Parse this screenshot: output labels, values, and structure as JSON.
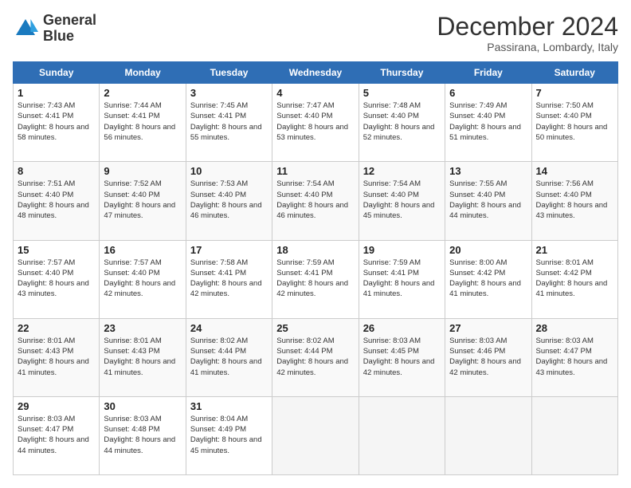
{
  "header": {
    "logo_line1": "General",
    "logo_line2": "Blue",
    "month": "December 2024",
    "location": "Passirana, Lombardy, Italy"
  },
  "weekdays": [
    "Sunday",
    "Monday",
    "Tuesday",
    "Wednesday",
    "Thursday",
    "Friday",
    "Saturday"
  ],
  "weeks": [
    [
      {
        "day": "1",
        "sunrise": "7:43 AM",
        "sunset": "4:41 PM",
        "daylight": "8 hours and 58 minutes."
      },
      {
        "day": "2",
        "sunrise": "7:44 AM",
        "sunset": "4:41 PM",
        "daylight": "8 hours and 56 minutes."
      },
      {
        "day": "3",
        "sunrise": "7:45 AM",
        "sunset": "4:41 PM",
        "daylight": "8 hours and 55 minutes."
      },
      {
        "day": "4",
        "sunrise": "7:47 AM",
        "sunset": "4:40 PM",
        "daylight": "8 hours and 53 minutes."
      },
      {
        "day": "5",
        "sunrise": "7:48 AM",
        "sunset": "4:40 PM",
        "daylight": "8 hours and 52 minutes."
      },
      {
        "day": "6",
        "sunrise": "7:49 AM",
        "sunset": "4:40 PM",
        "daylight": "8 hours and 51 minutes."
      },
      {
        "day": "7",
        "sunrise": "7:50 AM",
        "sunset": "4:40 PM",
        "daylight": "8 hours and 50 minutes."
      }
    ],
    [
      {
        "day": "8",
        "sunrise": "7:51 AM",
        "sunset": "4:40 PM",
        "daylight": "8 hours and 48 minutes."
      },
      {
        "day": "9",
        "sunrise": "7:52 AM",
        "sunset": "4:40 PM",
        "daylight": "8 hours and 47 minutes."
      },
      {
        "day": "10",
        "sunrise": "7:53 AM",
        "sunset": "4:40 PM",
        "daylight": "8 hours and 46 minutes."
      },
      {
        "day": "11",
        "sunrise": "7:54 AM",
        "sunset": "4:40 PM",
        "daylight": "8 hours and 46 minutes."
      },
      {
        "day": "12",
        "sunrise": "7:54 AM",
        "sunset": "4:40 PM",
        "daylight": "8 hours and 45 minutes."
      },
      {
        "day": "13",
        "sunrise": "7:55 AM",
        "sunset": "4:40 PM",
        "daylight": "8 hours and 44 minutes."
      },
      {
        "day": "14",
        "sunrise": "7:56 AM",
        "sunset": "4:40 PM",
        "daylight": "8 hours and 43 minutes."
      }
    ],
    [
      {
        "day": "15",
        "sunrise": "7:57 AM",
        "sunset": "4:40 PM",
        "daylight": "8 hours and 43 minutes."
      },
      {
        "day": "16",
        "sunrise": "7:57 AM",
        "sunset": "4:40 PM",
        "daylight": "8 hours and 42 minutes."
      },
      {
        "day": "17",
        "sunrise": "7:58 AM",
        "sunset": "4:41 PM",
        "daylight": "8 hours and 42 minutes."
      },
      {
        "day": "18",
        "sunrise": "7:59 AM",
        "sunset": "4:41 PM",
        "daylight": "8 hours and 42 minutes."
      },
      {
        "day": "19",
        "sunrise": "7:59 AM",
        "sunset": "4:41 PM",
        "daylight": "8 hours and 41 minutes."
      },
      {
        "day": "20",
        "sunrise": "8:00 AM",
        "sunset": "4:42 PM",
        "daylight": "8 hours and 41 minutes."
      },
      {
        "day": "21",
        "sunrise": "8:01 AM",
        "sunset": "4:42 PM",
        "daylight": "8 hours and 41 minutes."
      }
    ],
    [
      {
        "day": "22",
        "sunrise": "8:01 AM",
        "sunset": "4:43 PM",
        "daylight": "8 hours and 41 minutes."
      },
      {
        "day": "23",
        "sunrise": "8:01 AM",
        "sunset": "4:43 PM",
        "daylight": "8 hours and 41 minutes."
      },
      {
        "day": "24",
        "sunrise": "8:02 AM",
        "sunset": "4:44 PM",
        "daylight": "8 hours and 41 minutes."
      },
      {
        "day": "25",
        "sunrise": "8:02 AM",
        "sunset": "4:44 PM",
        "daylight": "8 hours and 42 minutes."
      },
      {
        "day": "26",
        "sunrise": "8:03 AM",
        "sunset": "4:45 PM",
        "daylight": "8 hours and 42 minutes."
      },
      {
        "day": "27",
        "sunrise": "8:03 AM",
        "sunset": "4:46 PM",
        "daylight": "8 hours and 42 minutes."
      },
      {
        "day": "28",
        "sunrise": "8:03 AM",
        "sunset": "4:47 PM",
        "daylight": "8 hours and 43 minutes."
      }
    ],
    [
      {
        "day": "29",
        "sunrise": "8:03 AM",
        "sunset": "4:47 PM",
        "daylight": "8 hours and 44 minutes."
      },
      {
        "day": "30",
        "sunrise": "8:03 AM",
        "sunset": "4:48 PM",
        "daylight": "8 hours and 44 minutes."
      },
      {
        "day": "31",
        "sunrise": "8:04 AM",
        "sunset": "4:49 PM",
        "daylight": "8 hours and 45 minutes."
      },
      null,
      null,
      null,
      null
    ]
  ]
}
